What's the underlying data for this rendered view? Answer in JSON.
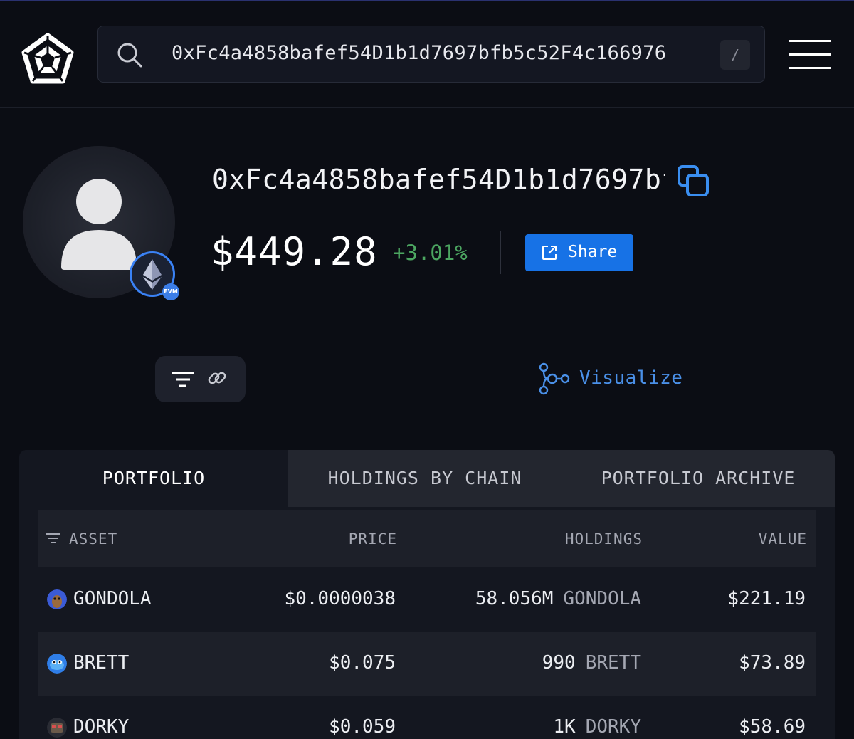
{
  "header": {
    "search_value": "0xFc4a4858bafef54D1b1d7697bfb5c52F4c166976",
    "search_shortcut": "/",
    "logo_icon": "arkham-logo-icon",
    "menu_icon": "hamburger-menu-icon"
  },
  "profile": {
    "address": "0xFc4a4858bafef54D1b1d7697bfb5c52F4c166976",
    "chain_badge": "EVM",
    "balance": "$449.28",
    "change": "+3.01%",
    "share_label": "Share",
    "visualize_label": "Visualize"
  },
  "tabs": [
    {
      "label": "PORTFOLIO",
      "active": true
    },
    {
      "label": "HOLDINGS BY CHAIN",
      "active": false
    },
    {
      "label": "PORTFOLIO ARCHIVE",
      "active": false
    }
  ],
  "table": {
    "columns": [
      "ASSET",
      "PRICE",
      "HOLDINGS",
      "VALUE"
    ],
    "rows": [
      {
        "asset": "GONDOLA",
        "price": "$0.0000038",
        "amount": "58.056M",
        "symbol": "GONDOLA",
        "value": "$221.19",
        "icon_color": "#3b5bd6"
      },
      {
        "asset": "BRETT",
        "price": "$0.075",
        "amount": "990",
        "symbol": "BRETT",
        "value": "$73.89",
        "icon_color": "#2f7ee8"
      },
      {
        "asset": "DORKY",
        "price": "$0.059",
        "amount": "1K",
        "symbol": "DORKY",
        "value": "$58.69",
        "icon_color": "#6b5a4a"
      }
    ]
  },
  "colors": {
    "background": "#0b0d14",
    "accent": "#1772e6",
    "positive": "#4ca661",
    "link": "#4a90e8"
  }
}
